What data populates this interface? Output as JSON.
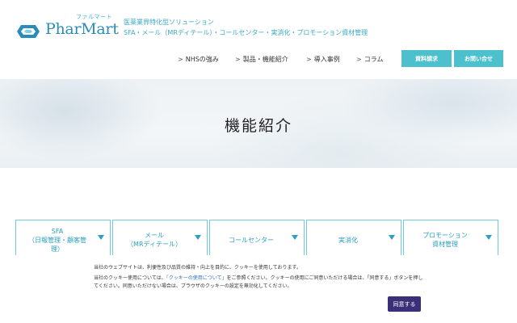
{
  "brand": {
    "kana": "ファルマート",
    "name": "PharMart",
    "tagline1": "医薬業界特化型ソリューション",
    "tagline2": "SFA・メール（MRディテール）・コールセンター・実消化・プロモーション資材管理",
    "accent": "#3ab4c8"
  },
  "nav": {
    "items": [
      {
        "label": "NHSの強み"
      },
      {
        "label": "製品・機能紹介"
      },
      {
        "label": "導入事例"
      },
      {
        "label": "コラム"
      }
    ],
    "doc_button": "資料請求",
    "contact_button": "お問い合せ"
  },
  "hero": {
    "title": "機能紹介"
  },
  "tabs": [
    {
      "label": "SFA\n（日報管理・顧客管\n理）"
    },
    {
      "label": "メール\n（MRディテール）"
    },
    {
      "label": "コールセンター"
    },
    {
      "label": "実消化"
    },
    {
      "label": "プロモーション\n資材管理"
    }
  ],
  "cookie": {
    "text1": "当社のウェブサイトは、利便性及び品質の維持・向上を目的に、クッキーを使用しております。",
    "text2_pre": "当社のクッキー使用については、",
    "text2_link": "「クッキーの使用について」",
    "text2_post": "をご参照ください。クッキーの使用にご同意いただける場合は、「同意する」ボタンを押してください。同意いただけない場合は、ブラウザのクッキーの設定を無効化してください。",
    "agree_label": "同意する",
    "button_color": "#3b2f7a"
  }
}
